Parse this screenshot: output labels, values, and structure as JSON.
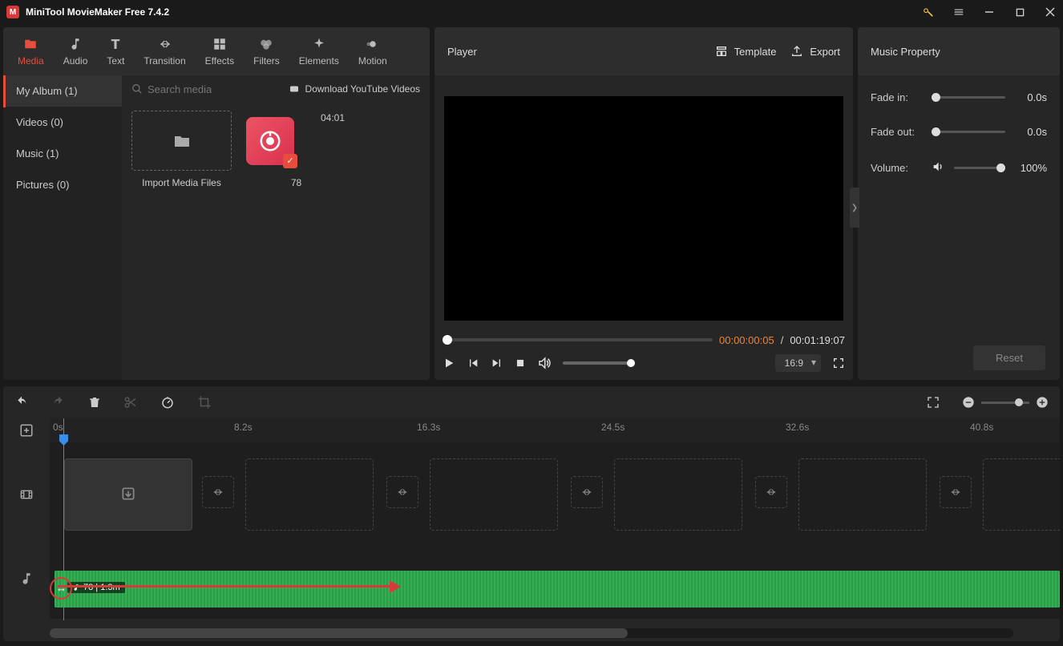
{
  "titlebar": {
    "app_title": "MiniTool MovieMaker Free 7.4.2"
  },
  "tabs": {
    "media": "Media",
    "audio": "Audio",
    "text": "Text",
    "transition": "Transition",
    "effects": "Effects",
    "filters": "Filters",
    "elements": "Elements",
    "motion": "Motion"
  },
  "sidebar": {
    "my_album": "My Album (1)",
    "videos": "Videos (0)",
    "music": "Music (1)",
    "pictures": "Pictures (0)"
  },
  "search": {
    "placeholder": "Search media"
  },
  "download_yt": "Download YouTube Videos",
  "import": {
    "label": "Import Media Files"
  },
  "audio_item": {
    "duration": "04:01",
    "name": "78"
  },
  "player": {
    "title": "Player",
    "template": "Template",
    "export": "Export",
    "current": "00:00:00:05",
    "sep": " / ",
    "total": "00:01:19:07",
    "ratio": "16:9"
  },
  "props": {
    "title": "Music Property",
    "fade_in": {
      "label": "Fade in:",
      "value": "0.0s"
    },
    "fade_out": {
      "label": "Fade out:",
      "value": "0.0s"
    },
    "volume": {
      "label": "Volume:",
      "value": "100%"
    },
    "reset": "Reset"
  },
  "timeline": {
    "ticks": [
      "0s",
      "8.2s",
      "16.3s",
      "24.5s",
      "32.6s",
      "40.8s"
    ],
    "audio_clip_label": "78 | 1.3m"
  }
}
